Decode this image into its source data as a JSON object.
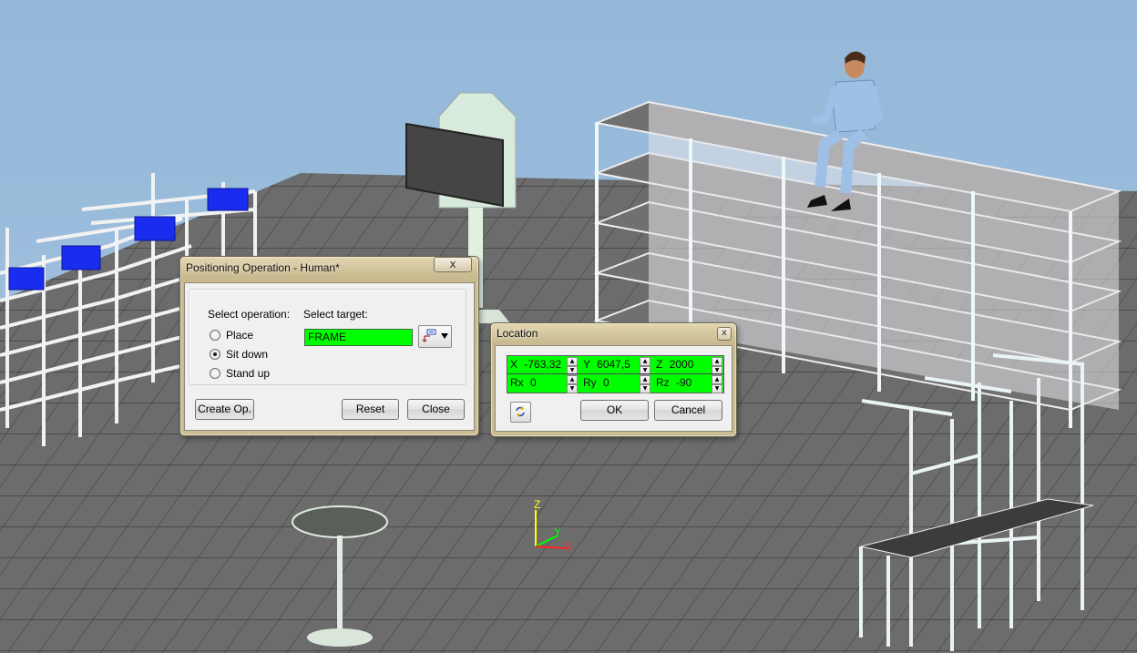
{
  "positioning_dialog": {
    "title": "Positioning Operation - Human*",
    "close_glyph": "x",
    "select_operation_label": "Select operation:",
    "select_target_label": "Select target:",
    "operations": [
      {
        "label": "Place",
        "selected": false
      },
      {
        "label": "Sit down",
        "selected": true
      },
      {
        "label": "Stand up",
        "selected": false
      }
    ],
    "target_value": "FRAME",
    "buttons": {
      "create": "Create Op.",
      "reset": "Reset",
      "close": "Close"
    }
  },
  "location_dialog": {
    "title": "Location",
    "close_glyph": "x",
    "fields": {
      "x": {
        "label": "X",
        "value": "-763,32"
      },
      "y": {
        "label": "Y",
        "value": "6047,5"
      },
      "z": {
        "label": "Z",
        "value": "2000"
      },
      "rx": {
        "label": "Rx",
        "value": "0"
      },
      "ry": {
        "label": "Ry",
        "value": "0"
      },
      "rz": {
        "label": "Rz",
        "value": "-90"
      }
    },
    "buttons": {
      "ok": "OK",
      "cancel": "Cancel"
    }
  },
  "axis_gizmo": {
    "z": "Z",
    "y": "Y",
    "x": "X"
  },
  "colors": {
    "field_green": "#00ff00",
    "sky": "#9dbdda",
    "floor": "#6e6e6e",
    "bin_blue": "#1a2cf0"
  },
  "icons": {
    "target_picker": "pick-target-icon",
    "refresh": "refresh-icon"
  }
}
